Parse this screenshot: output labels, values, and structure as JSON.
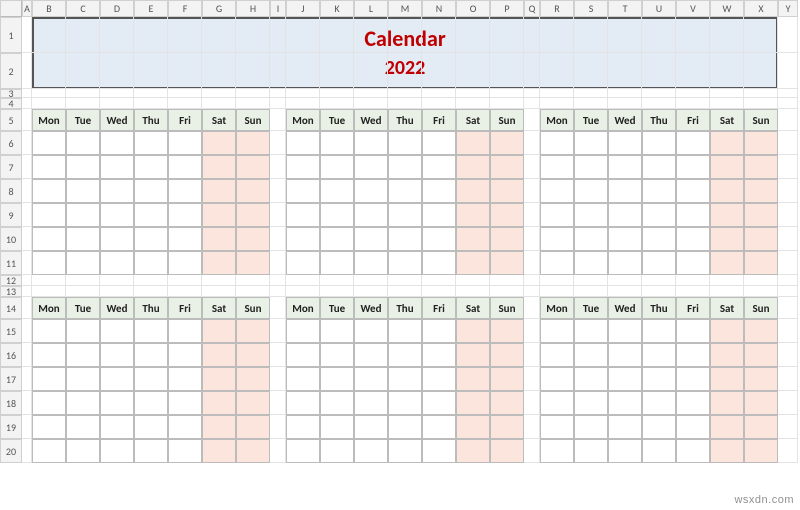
{
  "columns": [
    "A",
    "B",
    "C",
    "D",
    "E",
    "F",
    "G",
    "H",
    "I",
    "J",
    "K",
    "L",
    "M",
    "N",
    "O",
    "P",
    "Q",
    "R",
    "S",
    "T",
    "U",
    "V",
    "W",
    "X",
    "Y"
  ],
  "rows": [
    "1",
    "2",
    "3",
    "4",
    "5",
    "6",
    "7",
    "8",
    "9",
    "10",
    "11",
    "12",
    "13",
    "14",
    "15",
    "16",
    "17",
    "18",
    "19",
    "20"
  ],
  "title_line1": "Calendar",
  "title_line2": "2022",
  "day_labels": [
    "Mon",
    "Tue",
    "Wed",
    "Thu",
    "Fri",
    "Sat",
    "Sun"
  ],
  "watermark": "wsxdn.com",
  "colors": {
    "title_bg": "#e3ecf5",
    "title_text": "#c00000",
    "dayhdr_bg": "#e9f1e6",
    "weekend_bg": "#fbe5dc"
  }
}
